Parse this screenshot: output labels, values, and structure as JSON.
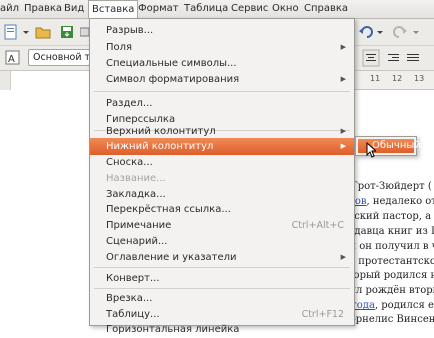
{
  "menubar": {
    "items": [
      "айл",
      "Правка",
      "Вид",
      "Вставка",
      "Формат",
      "Таблица",
      "Сервис",
      "Окно",
      "Справка"
    ]
  },
  "toolbar": {
    "paragraph_style": "Основной те"
  },
  "ruler": {
    "numbers": [
      "11",
      "12",
      "13"
    ]
  },
  "insert_menu": {
    "items": [
      {
        "label": "Разрыв...",
        "submenu": false
      },
      {
        "label": "Поля",
        "submenu": true
      },
      {
        "label": "Специальные символы...",
        "submenu": false
      },
      {
        "label": "Символ форматирования",
        "submenu": true
      },
      {
        "label": "Раздел...",
        "submenu": false
      },
      {
        "label": "Гиперссылка",
        "submenu": false
      },
      {
        "label": "Верхний колонтитул",
        "submenu": true
      },
      {
        "label": "Нижний колонтитул",
        "submenu": true,
        "highlighted": true
      },
      {
        "label": "Сноска...",
        "submenu": false
      },
      {
        "label": "Название...",
        "submenu": false,
        "disabled": true
      },
      {
        "label": "Закладка...",
        "submenu": false
      },
      {
        "label": "Перекрёстная ссылка...",
        "submenu": false
      },
      {
        "label": "Примечание",
        "submenu": false,
        "shortcut": "Ctrl+Alt+C"
      },
      {
        "label": "Сценарий...",
        "submenu": false
      },
      {
        "label": "Оглавление и указатели",
        "submenu": true
      },
      {
        "label": "Конверт...",
        "submenu": false
      },
      {
        "label": "Врезка...",
        "submenu": false
      },
      {
        "label": "Таблицу...",
        "submenu": false,
        "shortcut": "Ctrl+F12"
      },
      {
        "label": "Горизонтальная линейка",
        "submenu": false
      }
    ]
  },
  "footer_submenu": {
    "items": [
      "Обычный"
    ]
  },
  "document": {
    "lines": [
      {
        "pre": "е Грот-Зюйдерт (",
        "link": "",
        "post": ""
      },
      {
        "pre": "",
        "link": "ндов",
        "post": ", недалеко от"
      },
      {
        "pre": "нтский пастор, а м",
        "link": "",
        "post": ""
      },
      {
        "pre": "родавца книг из Г",
        "link": "",
        "post": ""
      },
      {
        "pre": "мя он получил в ч",
        "link": "",
        "post": ""
      },
      {
        "pre": "ил протестантско",
        "link": "",
        "post": ""
      },
      {
        "pre": "оторый родился н",
        "link": "",
        "post": ""
      },
      {
        "pre": "был рождён вторы",
        "link": "",
        "post": ""
      },
      {
        "pre": "",
        "link": "7 года",
        "post": ", родился ег"
      },
      {
        "pre": " Корнелис Винсент",
        "link": "",
        "post": ""
      }
    ]
  },
  "colors": {
    "highlight": "#e8703a",
    "menu_bg": "#f3f2f0",
    "link": "#2a4dc0"
  }
}
